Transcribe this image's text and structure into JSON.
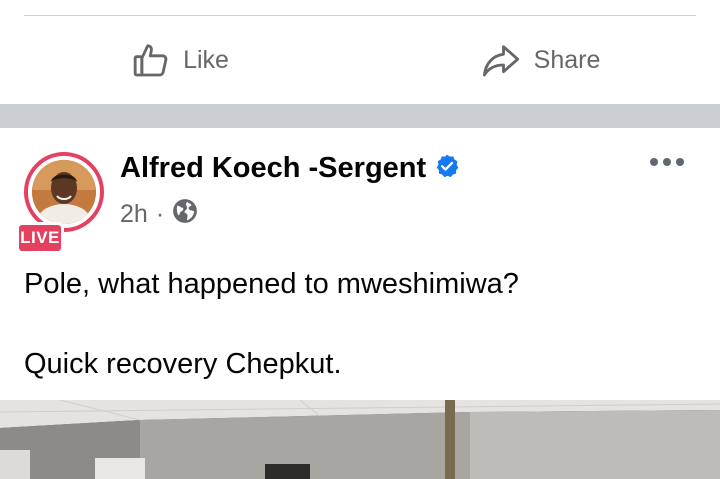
{
  "actions": {
    "like_label": "Like",
    "share_label": "Share"
  },
  "post": {
    "author_name": "Alfred Koech -Sergent",
    "verified": true,
    "live_badge": "LIVE",
    "time": "2h",
    "meta_separator": "·",
    "privacy_icon": "globe-icon",
    "text_lines": [
      "Pole, what happened to mweshimiwa?",
      "Quick recovery Chepkut."
    ]
  },
  "colors": {
    "verified_blue": "#1877f2",
    "live_red": "#e4405f",
    "muted_text": "#65676b",
    "separator": "#c9ccd1"
  }
}
